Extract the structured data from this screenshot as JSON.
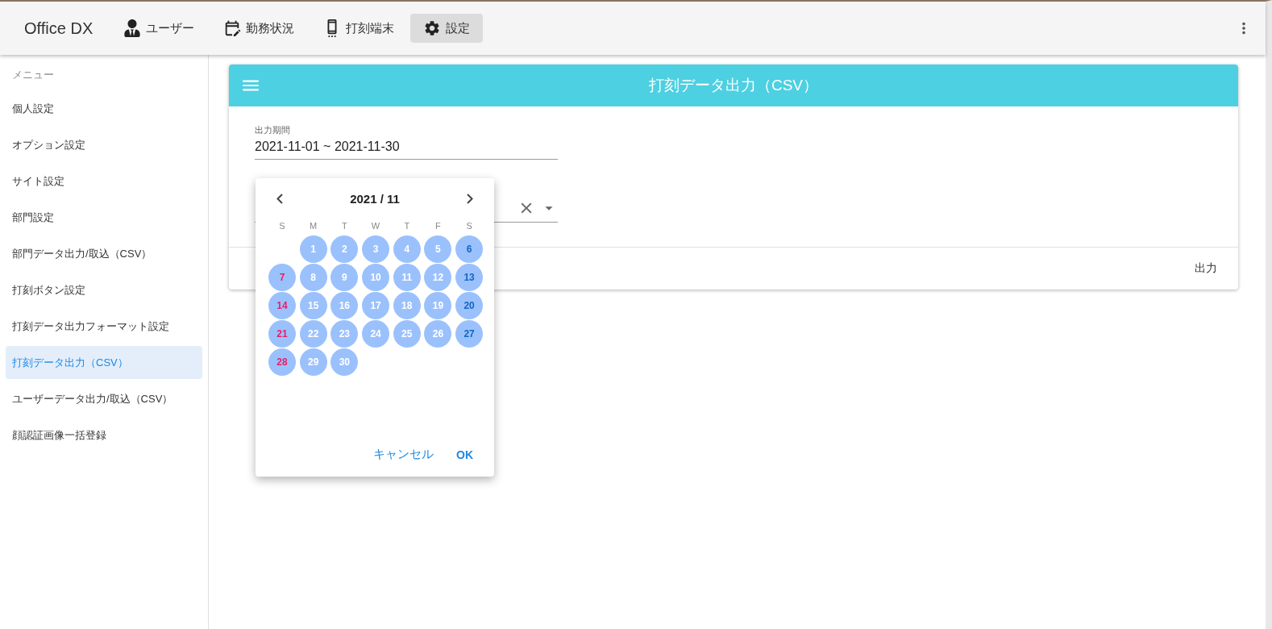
{
  "app_bar": {
    "title": "Office DX",
    "nav": [
      {
        "label": "ユーザー",
        "selected": false
      },
      {
        "label": "勤務状況",
        "selected": false
      },
      {
        "label": "打刻端末",
        "selected": false
      },
      {
        "label": "設定",
        "selected": true
      }
    ]
  },
  "sidebar": {
    "heading": "メニュー",
    "items": [
      {
        "label": "個人設定",
        "selected": false
      },
      {
        "label": "オプション設定",
        "selected": false
      },
      {
        "label": "サイト設定",
        "selected": false
      },
      {
        "label": "部門設定",
        "selected": false
      },
      {
        "label": "部門データ出力/取込（CSV）",
        "selected": false
      },
      {
        "label": "打刻ボタン設定",
        "selected": false
      },
      {
        "label": "打刻データ出力フォーマット設定",
        "selected": false
      },
      {
        "label": "打刻データ出力（CSV）",
        "selected": true
      },
      {
        "label": "ユーザーデータ出力/取込（CSV）",
        "selected": false
      },
      {
        "label": "顔認証画像一括登録",
        "selected": false
      }
    ]
  },
  "card": {
    "title": "打刻データ出力（CSV）",
    "period_field": {
      "label": "出力期間",
      "value": "2021-11-01 ~ 2021-11-30"
    },
    "action": "出力"
  },
  "date_picker": {
    "month": "2021 / 11",
    "weekdays": [
      "S",
      "M",
      "T",
      "W",
      "T",
      "F",
      "S"
    ],
    "weeks": [
      {
        "days": [
          {
            "n": "1",
            "kind": "weekday",
            "in_range": true
          },
          {
            "n": "2",
            "kind": "weekday",
            "in_range": true
          },
          {
            "n": "3",
            "kind": "weekday",
            "in_range": true
          },
          {
            "n": "4",
            "kind": "weekday",
            "in_range": true
          },
          {
            "n": "5",
            "kind": "weekday",
            "in_range": true
          },
          {
            "n": "6",
            "kind": "saturday",
            "in_range": true
          }
        ]
      },
      {
        "days": [
          {
            "n": "7",
            "kind": "sunday",
            "in_range": true
          },
          {
            "n": "8",
            "kind": "weekday",
            "in_range": true
          },
          {
            "n": "9",
            "kind": "weekday",
            "in_range": true
          },
          {
            "n": "10",
            "kind": "weekday",
            "in_range": true
          },
          {
            "n": "11",
            "kind": "weekday",
            "in_range": true
          },
          {
            "n": "12",
            "kind": "weekday",
            "in_range": true
          },
          {
            "n": "13",
            "kind": "saturday",
            "in_range": true
          }
        ]
      },
      {
        "days": [
          {
            "n": "14",
            "kind": "sunday",
            "in_range": true
          },
          {
            "n": "15",
            "kind": "weekday",
            "in_range": true
          },
          {
            "n": "16",
            "kind": "weekday",
            "in_range": true
          },
          {
            "n": "17",
            "kind": "weekday",
            "in_range": true
          },
          {
            "n": "18",
            "kind": "weekday",
            "in_range": true
          },
          {
            "n": "19",
            "kind": "weekday",
            "in_range": true
          },
          {
            "n": "20",
            "kind": "saturday",
            "in_range": true
          }
        ]
      },
      {
        "days": [
          {
            "n": "21",
            "kind": "sunday",
            "in_range": true
          },
          {
            "n": "22",
            "kind": "weekday",
            "in_range": true
          },
          {
            "n": "23",
            "kind": "weekday",
            "in_range": true
          },
          {
            "n": "24",
            "kind": "weekday",
            "in_range": true
          },
          {
            "n": "25",
            "kind": "weekday",
            "in_range": true
          },
          {
            "n": "26",
            "kind": "weekday",
            "in_range": true
          },
          {
            "n": "27",
            "kind": "saturday",
            "in_range": true
          }
        ]
      },
      {
        "days": [
          {
            "n": "28",
            "kind": "sunday",
            "in_range": true
          },
          {
            "n": "29",
            "kind": "weekday",
            "in_range": true
          },
          {
            "n": "30",
            "kind": "weekday",
            "in_range": true
          }
        ]
      }
    ],
    "buttons": [
      "キャンセル",
      "OK"
    ]
  }
}
